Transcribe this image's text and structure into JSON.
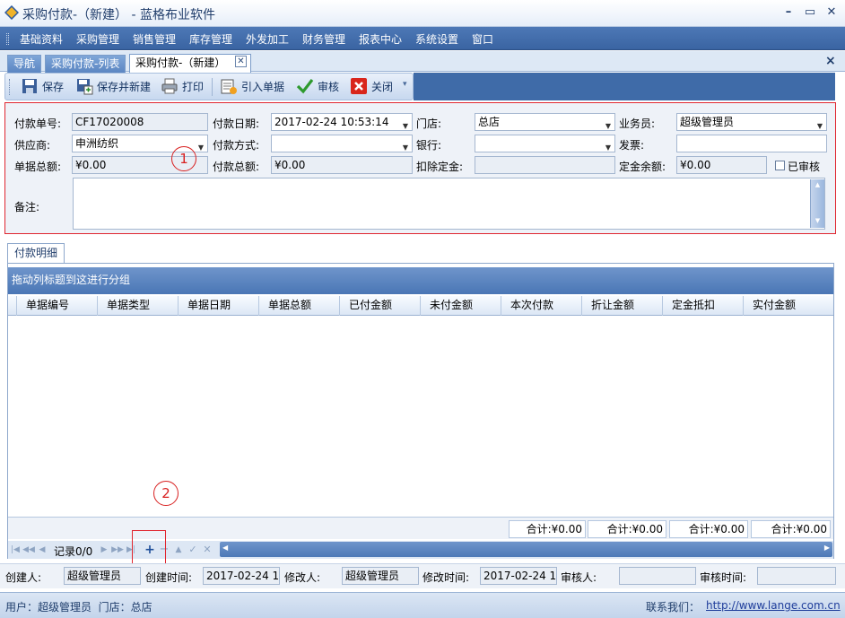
{
  "window": {
    "title": "采购付款-（新建） - 蓝格布业软件",
    "min_icon": "minimize-icon",
    "max_icon": "restore-icon",
    "close_icon": "close-icon"
  },
  "menu": [
    "基础资料",
    "采购管理",
    "销售管理",
    "库存管理",
    "外发加工",
    "财务管理",
    "报表中心",
    "系统设置",
    "窗口"
  ],
  "tabs": {
    "nav": "导航",
    "list": "采购付款-列表",
    "current": "采购付款-（新建）",
    "close": "✕",
    "panel_close": "×"
  },
  "toolbar": {
    "save": "保存",
    "save_new": "保存并新建",
    "print": "打印",
    "import": "引入单据",
    "audit": "审核",
    "close": "关闭"
  },
  "form": {
    "doc_no_label": "付款单号:",
    "doc_no": "CF17020008",
    "pay_date_label": "付款日期:",
    "pay_date": "2017-02-24 10:53:14",
    "store_label": "门店:",
    "store": "总店",
    "salesman_label": "业务员:",
    "salesman": "超级管理员",
    "supplier_label": "供应商:",
    "supplier": "申洲纺织",
    "pay_method_label": "付款方式:",
    "pay_method": "",
    "bank_label": "银行:",
    "bank": "",
    "invoice_label": "发票:",
    "invoice": "",
    "total_label": "单据总额:",
    "total": "¥0.00",
    "pay_total_label": "付款总额:",
    "pay_total": "¥0.00",
    "deduct_label": "扣除定金:",
    "deduct": "",
    "deposit_label": "定金余额:",
    "deposit": "¥0.00",
    "audited_label": "已审核",
    "remark_label": "备注:"
  },
  "annotations": {
    "one": "1",
    "two": "2"
  },
  "detail": {
    "tab": "付款明细",
    "group_hint": "拖动列标题到这进行分组",
    "columns": [
      "单据编号",
      "单据类型",
      "单据日期",
      "单据总额",
      "已付金额",
      "未付金额",
      "本次付款",
      "折让金额",
      "定金抵扣",
      "实付金额"
    ],
    "sums": [
      "合计:¥0.00",
      "合计:¥0.00",
      "合计:¥0.00",
      "合计:¥0.00"
    ],
    "navigator_record": "记录0/0"
  },
  "info": {
    "creator_label": "创建人:",
    "creator": "超级管理员",
    "created_label": "创建时间:",
    "created": "2017-02-24 10",
    "modifier_label": "修改人:",
    "modifier": "超级管理员",
    "modified_label": "修改时间:",
    "modified": "2017-02-24 10",
    "auditor_label": "审核人:",
    "auditor": "",
    "audit_time_label": "审核时间:",
    "audit_time": ""
  },
  "status": {
    "user": "用户：超级管理员  门店：总店",
    "contact_label": "联系我们：",
    "contact_url": "http://www.lange.com.cn"
  },
  "colors": {
    "accent": "#3f6ba8",
    "highlight_red": "#e0262f"
  }
}
